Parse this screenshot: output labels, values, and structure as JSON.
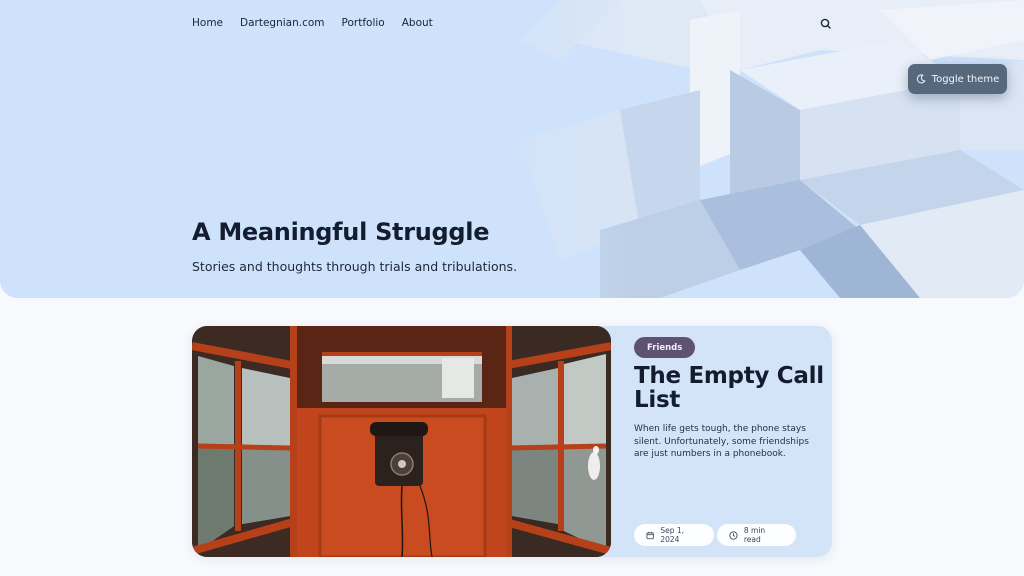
{
  "nav": {
    "items": [
      "Home",
      "Dartegnian.com",
      "Portfolio",
      "About"
    ]
  },
  "header": {
    "search_icon": "search-icon",
    "toggle_theme_label": "Toggle theme",
    "toggle_icon": "moon-icon"
  },
  "hero": {
    "title": "A Meaningful Struggle",
    "subtitle": "Stories and thoughts through trials and tribulations."
  },
  "post": {
    "tag": "Friends",
    "title": "The Empty Call List",
    "excerpt": "When life gets tough, the phone stays silent. Unfortunately, some friendships are just numbers in a phonebook.",
    "date": "Sep 1, 2024",
    "read_time": "8 min read"
  },
  "colors": {
    "hero_bg": "#cfe2fb",
    "card_bg": "#d3e3f8",
    "tag_bg": "#5e5273",
    "toggle_bg": "#57677c",
    "booth_red": "#c0451d"
  }
}
